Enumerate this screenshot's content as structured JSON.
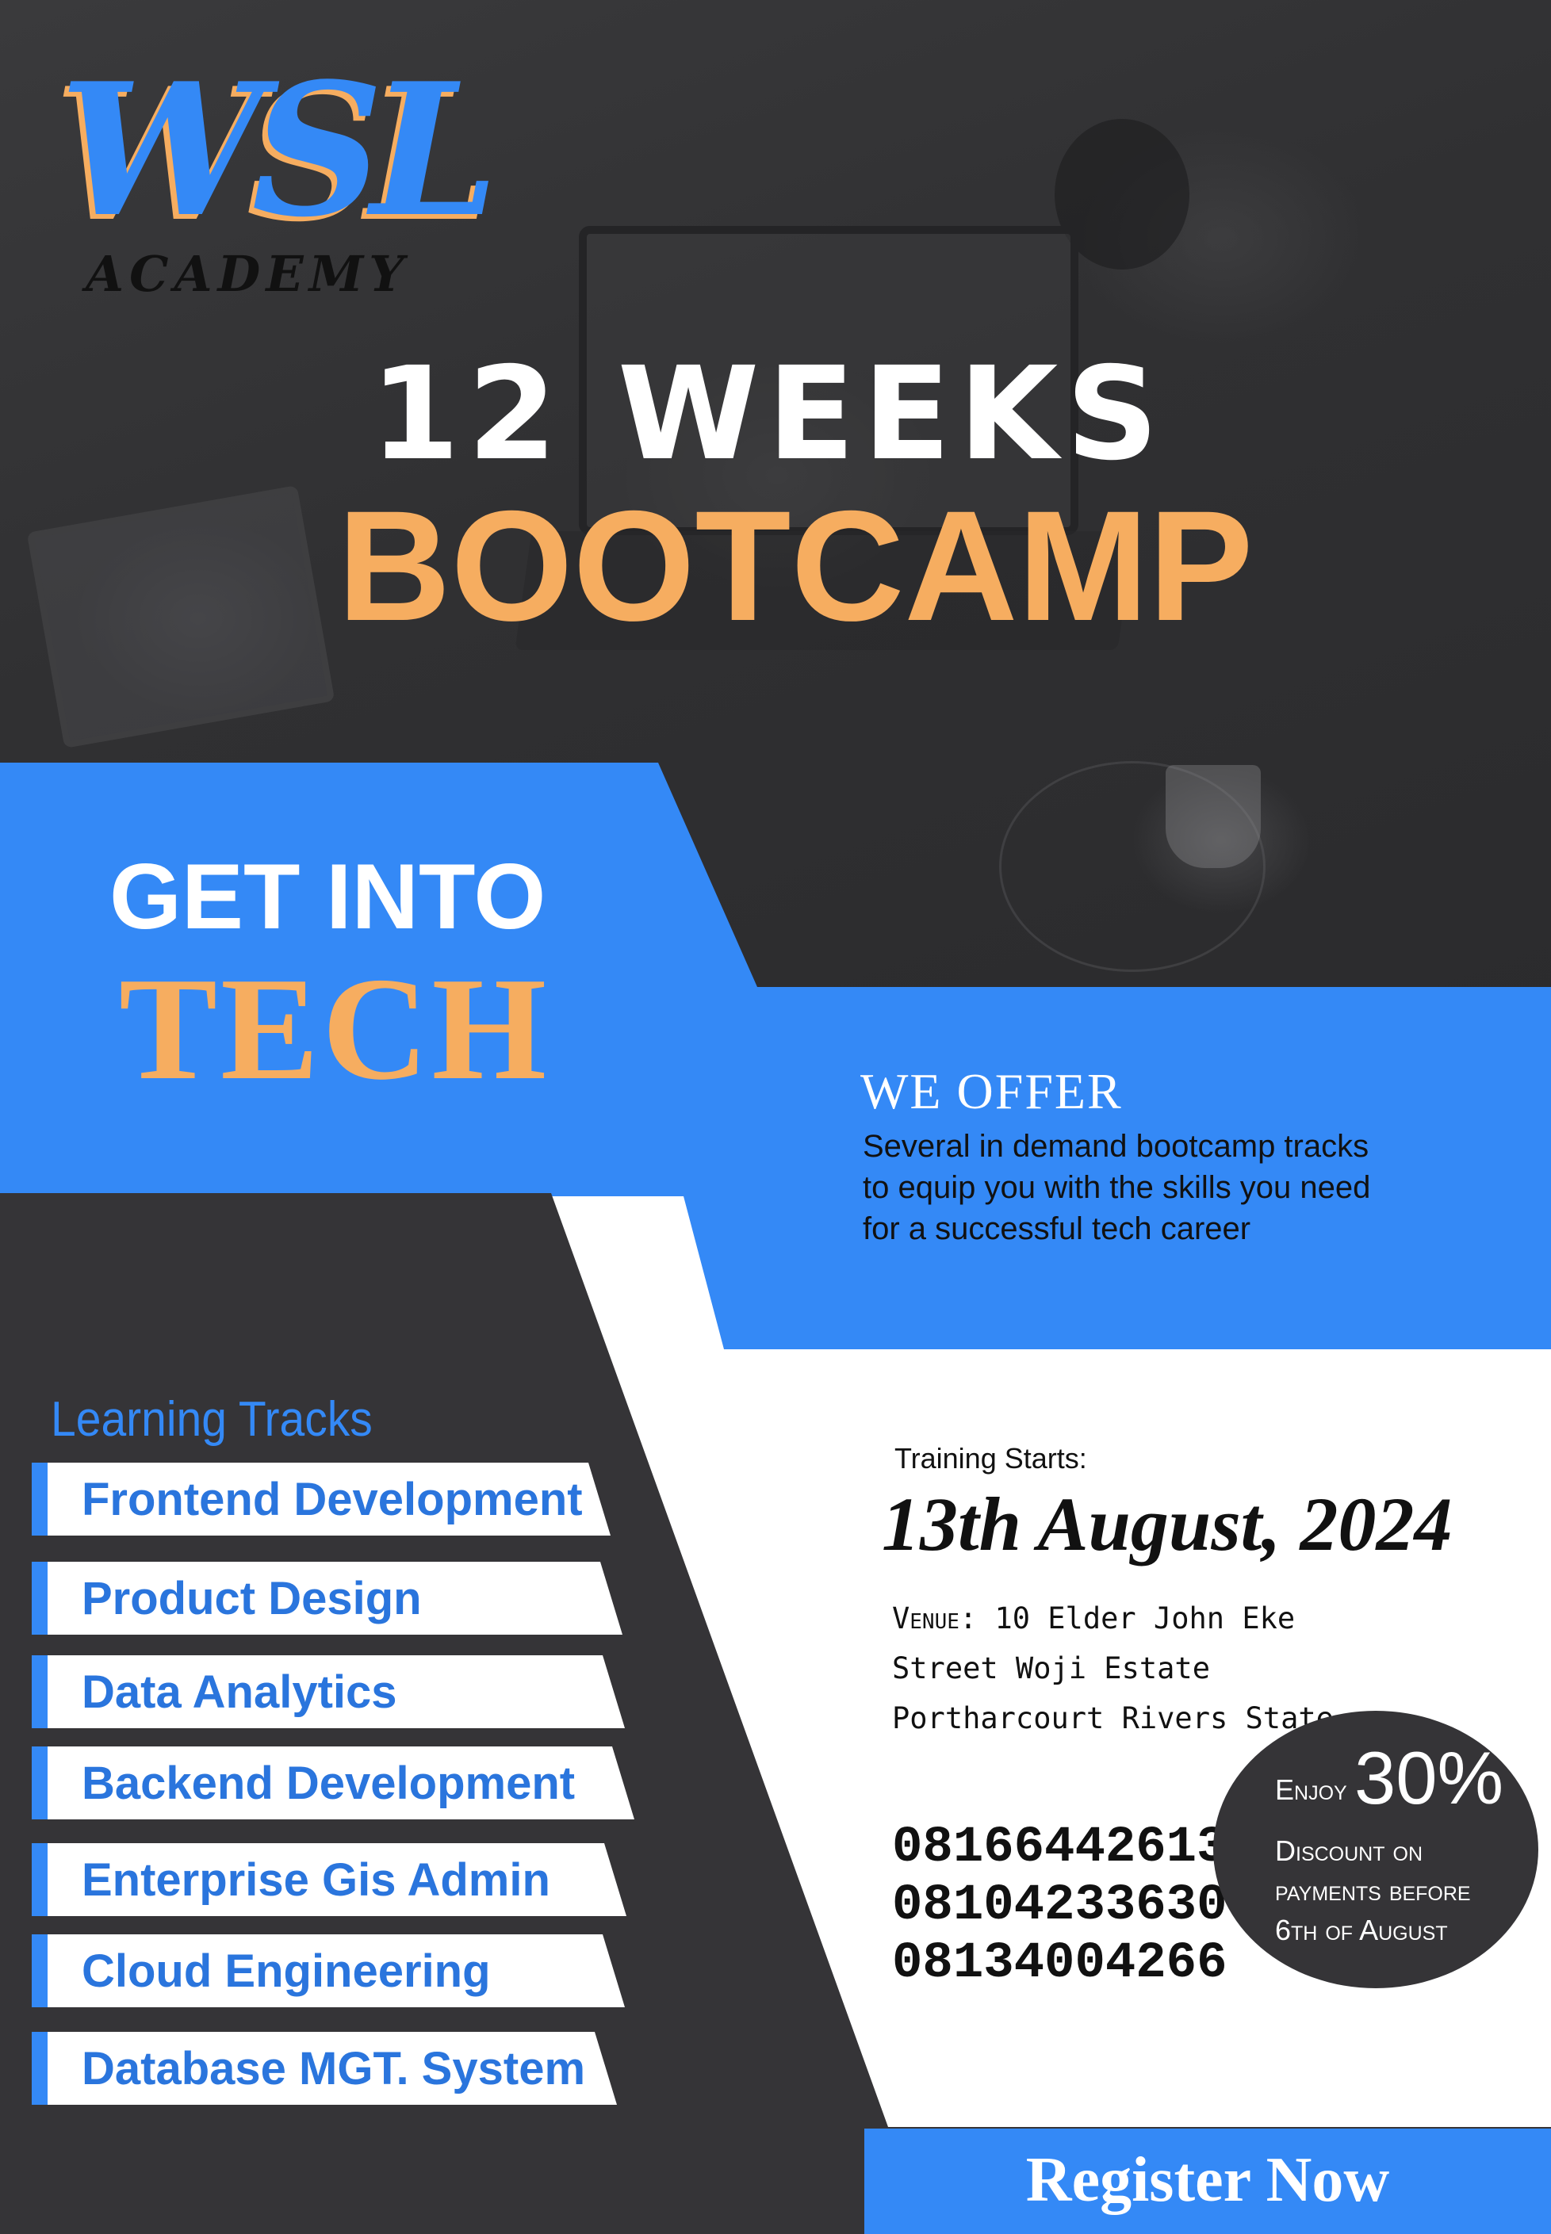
{
  "logo": {
    "brand": "WSL",
    "subtitle": "ACADEMY"
  },
  "headline": {
    "weeks": "12 WEEKS",
    "bootcamp": "BOOTCAMP"
  },
  "cta": {
    "line1": "GET INTO",
    "line2": "TECH"
  },
  "offer": {
    "title": "WE OFFER",
    "lines": [
      "Several in demand  bootcamp tracks",
      "to equip you with the skills you need",
      "for a successful tech career"
    ]
  },
  "tracks": {
    "heading": "Learning Tracks",
    "items": [
      "Frontend Development",
      "Product Design",
      "Data Analytics",
      "Backend Development",
      "Enterprise Gis Admin",
      "Cloud Engineering",
      "Database MGT. System"
    ]
  },
  "training": {
    "label": "Training Starts:",
    "date": "13th August, 2024"
  },
  "venue": {
    "label": "Venue:",
    "line1": "10 Elder John Eke",
    "line2": "Street Woji Estate",
    "line3": "Portharcourt Rivers State"
  },
  "phones": [
    "08166442613",
    "08104233630",
    "08134004266"
  ],
  "discount": {
    "enjoy": "Enjoy",
    "percent": "30%",
    "lines": [
      "Discount on",
      "payments before",
      "6th of August"
    ]
  },
  "register_label": "Register Now",
  "colors": {
    "blue": "#3489f6",
    "orange": "#f6ad60",
    "dark": "#353437",
    "white": "#ffffff"
  }
}
